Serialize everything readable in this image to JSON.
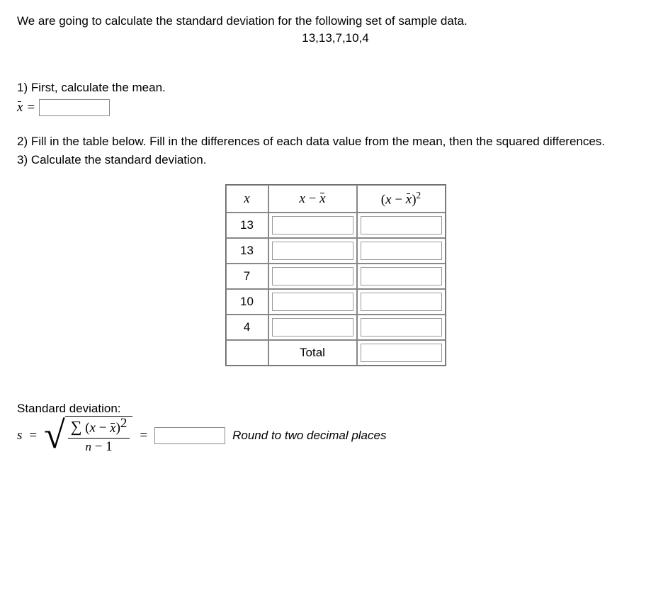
{
  "intro": "We are going to calculate the standard deviation for the following set of sample data.",
  "dataset": "13,13,7,10,4",
  "steps": {
    "s1": "1) First, calculate the mean.",
    "s2": "2) Fill in the table below. Fill in the differences of each data value from the mean, then the squared differences.",
    "s3": "3) Calculate the standard deviation."
  },
  "mean": {
    "value": ""
  },
  "table": {
    "headers": {
      "x": "x",
      "diff": "x − x̄",
      "sq": "(x − x̄)²"
    },
    "rows": [
      {
        "x": "13",
        "diff": "",
        "sq": ""
      },
      {
        "x": "13",
        "diff": "",
        "sq": ""
      },
      {
        "x": "7",
        "diff": "",
        "sq": ""
      },
      {
        "x": "10",
        "diff": "",
        "sq": ""
      },
      {
        "x": "4",
        "diff": "",
        "sq": ""
      }
    ],
    "total_label": "Total",
    "total_value": ""
  },
  "std": {
    "label": "Standard deviation:",
    "value": "",
    "note": "Round to two decimal places"
  }
}
